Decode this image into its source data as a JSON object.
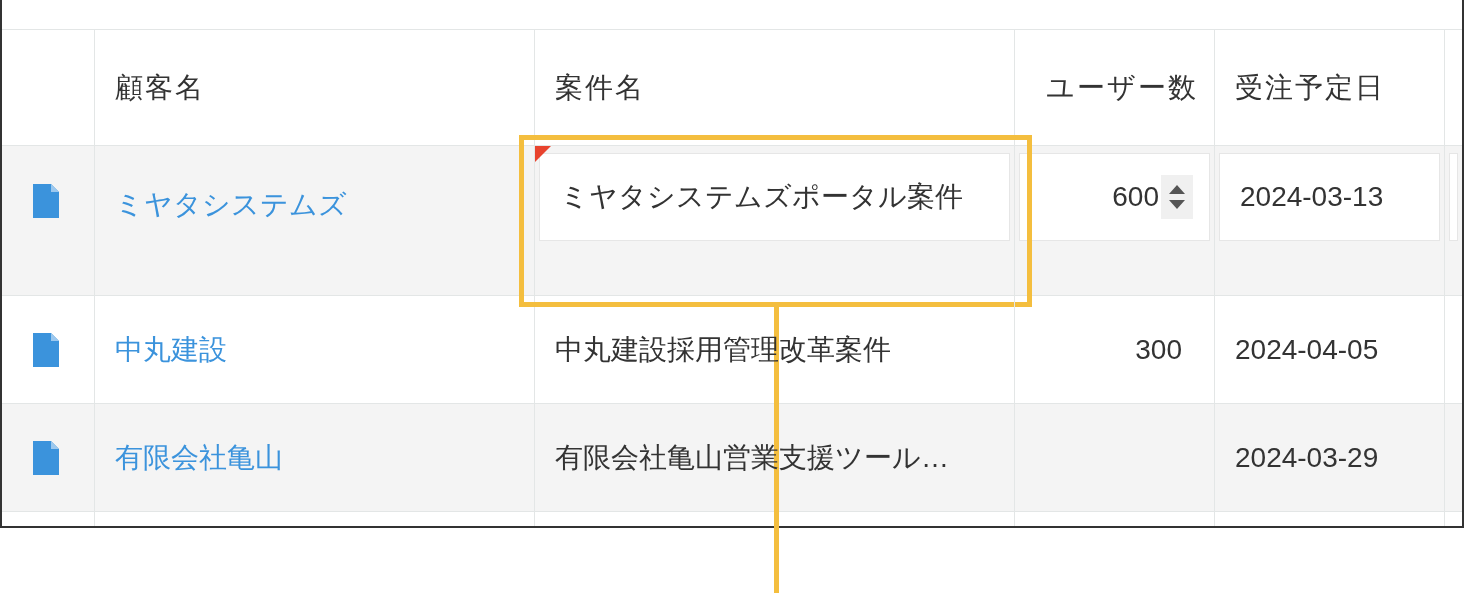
{
  "table": {
    "columns": [
      "顧客名",
      "案件名",
      "ユーザー数",
      "受注予定日"
    ],
    "rows": [
      {
        "editing": true,
        "customer": "ミヤタシステムズ",
        "project": {
          "text": "ミヤタシステムズポータル案件",
          "modified": true,
          "highlighted": true
        },
        "users": "600",
        "date": "2024-03-13"
      },
      {
        "editing": false,
        "customer": "中丸建設",
        "project": {
          "text": "中丸建設採用管理改革案件",
          "modified": false,
          "highlighted": false
        },
        "users": "300",
        "date": "2024-04-05"
      },
      {
        "editing": false,
        "customer": "有限会社亀山",
        "project": {
          "text": "有限会社亀山営業支援ツール…",
          "modified": false,
          "highlighted": false
        },
        "date": "2024-03-29"
      }
    ]
  }
}
